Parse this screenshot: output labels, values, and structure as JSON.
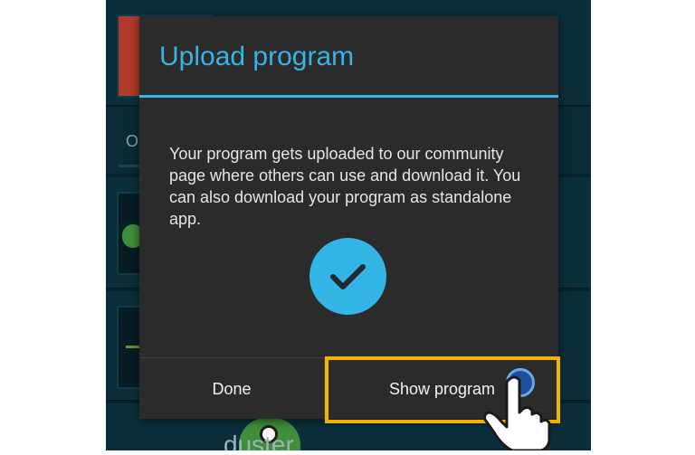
{
  "dialog": {
    "title": "Upload program",
    "message": "Your program gets uploaded to our community page where others can use and download it. You can also download your program as standalone app.",
    "done_label": "Done",
    "show_program_label": "Show program"
  },
  "background": {
    "tab_partial_label": "O",
    "item_partial_label": "duster"
  },
  "colors": {
    "accent": "#33b5e5",
    "dialog_bg": "#2b2b2b",
    "highlight": "#f2b200",
    "app_bg": "#06222b"
  },
  "icons": {
    "success": "checkmark-icon",
    "pointer": "hand-pointer-icon"
  }
}
